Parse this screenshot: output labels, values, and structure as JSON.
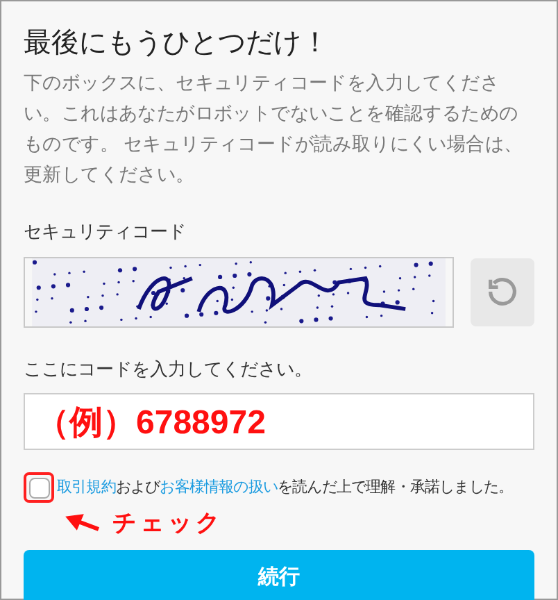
{
  "title": "最後にもうひとつだけ！",
  "description": "下のボックスに、セキュリティコードを入力してください。これはあなたがロボットでないことを確認するためのものです。 セキュリティコードが読み取りにくい場合は、更新してください。",
  "captcha": {
    "label": "セキュリティコード"
  },
  "code_field": {
    "label": "ここにコードを入力してください。",
    "value": "（例）6788972"
  },
  "agreement": {
    "checked": false,
    "parts": [
      {
        "kind": "link",
        "text": "取引規約"
      },
      {
        "kind": "text",
        "text": "および"
      },
      {
        "kind": "link",
        "text": "お客様情報の扱い"
      },
      {
        "kind": "text",
        "text": "を読んだ上で理解・承諾しました。"
      }
    ]
  },
  "annotation": {
    "text": "チェック"
  },
  "submit_button": {
    "label": "続行"
  }
}
